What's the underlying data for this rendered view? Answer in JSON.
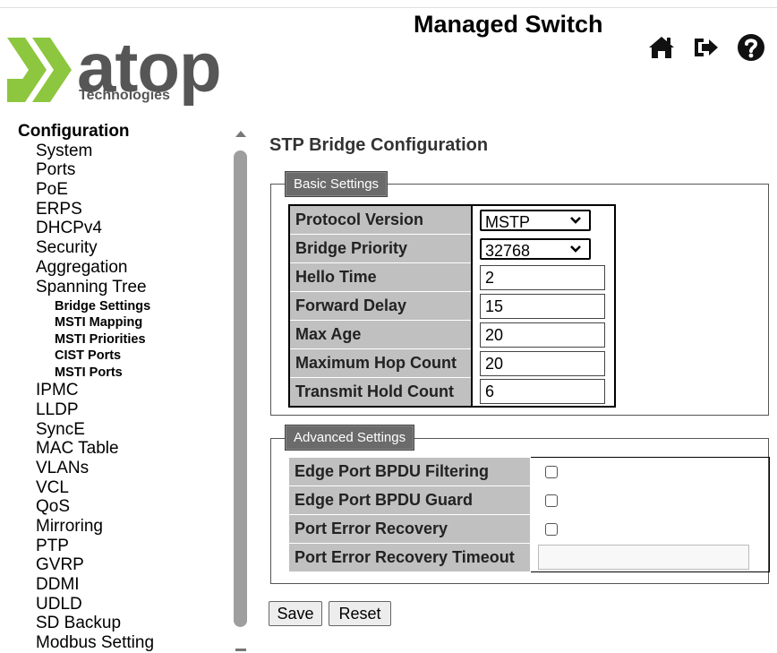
{
  "header": {
    "title": "Managed Switch",
    "logo_text": "atop",
    "logo_sub": "Technologies",
    "icons": [
      "home-icon",
      "logout-icon",
      "help-icon"
    ]
  },
  "sidebar": {
    "heading": "Configuration",
    "items": [
      {
        "label": "System"
      },
      {
        "label": "Ports"
      },
      {
        "label": "PoE"
      },
      {
        "label": "ERPS"
      },
      {
        "label": "DHCPv4"
      },
      {
        "label": "Security"
      },
      {
        "label": "Aggregation"
      },
      {
        "label": "Spanning Tree"
      },
      {
        "label": "IPMC"
      },
      {
        "label": "LLDP"
      },
      {
        "label": "SyncE"
      },
      {
        "label": "MAC Table"
      },
      {
        "label": "VLANs"
      },
      {
        "label": "VCL"
      },
      {
        "label": "QoS"
      },
      {
        "label": "Mirroring"
      },
      {
        "label": "PTP"
      },
      {
        "label": "GVRP"
      },
      {
        "label": "DDMI"
      },
      {
        "label": "UDLD"
      },
      {
        "label": "SD Backup"
      },
      {
        "label": "Modbus Setting"
      }
    ],
    "spanning_tree_sub": [
      {
        "label": "Bridge Settings"
      },
      {
        "label": "MSTI Mapping"
      },
      {
        "label": "MSTI Priorities"
      },
      {
        "label": "CIST Ports"
      },
      {
        "label": "MSTI Ports"
      }
    ]
  },
  "main": {
    "title": "STP Bridge Configuration",
    "basic": {
      "legend": "Basic Settings",
      "rows": [
        {
          "label": "Protocol Version",
          "value": "MSTP",
          "type": "select"
        },
        {
          "label": "Bridge Priority",
          "value": "32768",
          "type": "select"
        },
        {
          "label": "Hello Time",
          "value": "2",
          "type": "text"
        },
        {
          "label": "Forward Delay",
          "value": "15",
          "type": "text"
        },
        {
          "label": "Max Age",
          "value": "20",
          "type": "text"
        },
        {
          "label": "Maximum Hop Count",
          "value": "20",
          "type": "text"
        },
        {
          "label": "Transmit Hold Count",
          "value": "6",
          "type": "text"
        }
      ]
    },
    "advanced": {
      "legend": "Advanced Settings",
      "rows": [
        {
          "label": "Edge Port BPDU Filtering",
          "checked": false
        },
        {
          "label": "Edge Port BPDU Guard",
          "checked": false
        },
        {
          "label": "Port Error Recovery",
          "checked": false
        },
        {
          "label": "Port Error Recovery Timeout",
          "value": ""
        }
      ]
    },
    "buttons": {
      "save": "Save",
      "reset": "Reset"
    }
  },
  "colors": {
    "logo_green": "#8dc63f",
    "label_bg": "#c0c0c0",
    "legend_bg": "#6b6b6b"
  }
}
